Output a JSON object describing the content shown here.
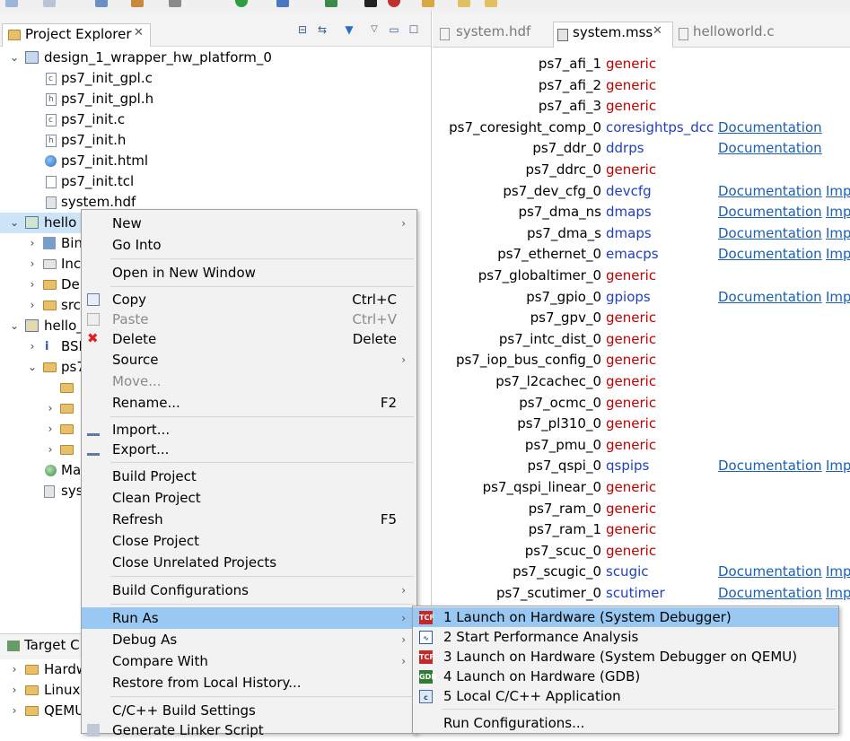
{
  "left_panel": {
    "tab_title": "Project Explorer",
    "tree": [
      {
        "label": "design_1_wrapper_hw_platform_0"
      },
      {
        "label": "ps7_init_gpl.c"
      },
      {
        "label": "ps7_init_gpl.h"
      },
      {
        "label": "ps7_init.c"
      },
      {
        "label": "ps7_init.h"
      },
      {
        "label": "ps7_init.html"
      },
      {
        "label": "ps7_init.tcl"
      },
      {
        "label": "system.hdf"
      },
      {
        "label": "hello"
      },
      {
        "label": "Bin"
      },
      {
        "label": "Inc"
      },
      {
        "label": "De"
      },
      {
        "label": "src"
      },
      {
        "label": "hello_"
      },
      {
        "label": "BSI"
      },
      {
        "label": "ps7"
      },
      {
        "label": "Ma"
      },
      {
        "label": "sys"
      }
    ]
  },
  "target_panel": {
    "tab_title": "Target C",
    "items": [
      "Hardw",
      "Linux",
      "QEMU"
    ]
  },
  "editor": {
    "tabs": [
      {
        "label": "system.hdf"
      },
      {
        "label": "system.mss"
      },
      {
        "label": "helloworld.c"
      }
    ],
    "doc_label": "Documentation",
    "imp_label": "Imp",
    "rows": [
      {
        "name": "ps7_afi_1",
        "driver": "generic",
        "doc": false,
        "imp": false
      },
      {
        "name": "ps7_afi_2",
        "driver": "generic",
        "doc": false,
        "imp": false
      },
      {
        "name": "ps7_afi_3",
        "driver": "generic",
        "doc": false,
        "imp": false
      },
      {
        "name": "ps7_coresight_comp_0",
        "driver": "coresightps_dcc",
        "doc": true,
        "imp": false
      },
      {
        "name": "ps7_ddr_0",
        "driver": "ddrps",
        "doc": true,
        "imp": false
      },
      {
        "name": "ps7_ddrc_0",
        "driver": "generic",
        "doc": false,
        "imp": false
      },
      {
        "name": "ps7_dev_cfg_0",
        "driver": "devcfg",
        "doc": true,
        "imp": true
      },
      {
        "name": "ps7_dma_ns",
        "driver": "dmaps",
        "doc": true,
        "imp": true
      },
      {
        "name": "ps7_dma_s",
        "driver": "dmaps",
        "doc": true,
        "imp": true
      },
      {
        "name": "ps7_ethernet_0",
        "driver": "emacps",
        "doc": true,
        "imp": true
      },
      {
        "name": "ps7_globaltimer_0",
        "driver": "generic",
        "doc": false,
        "imp": false
      },
      {
        "name": "ps7_gpio_0",
        "driver": "gpiops",
        "doc": true,
        "imp": true
      },
      {
        "name": "ps7_gpv_0",
        "driver": "generic",
        "doc": false,
        "imp": false
      },
      {
        "name": "ps7_intc_dist_0",
        "driver": "generic",
        "doc": false,
        "imp": false
      },
      {
        "name": "ps7_iop_bus_config_0",
        "driver": "generic",
        "doc": false,
        "imp": false
      },
      {
        "name": "ps7_l2cachec_0",
        "driver": "generic",
        "doc": false,
        "imp": false
      },
      {
        "name": "ps7_ocmc_0",
        "driver": "generic",
        "doc": false,
        "imp": false
      },
      {
        "name": "ps7_pl310_0",
        "driver": "generic",
        "doc": false,
        "imp": false
      },
      {
        "name": "ps7_pmu_0",
        "driver": "generic",
        "doc": false,
        "imp": false
      },
      {
        "name": "ps7_qspi_0",
        "driver": "qspips",
        "doc": true,
        "imp": true
      },
      {
        "name": "ps7_qspi_linear_0",
        "driver": "generic",
        "doc": false,
        "imp": false
      },
      {
        "name": "ps7_ram_0",
        "driver": "generic",
        "doc": false,
        "imp": false
      },
      {
        "name": "ps7_ram_1",
        "driver": "generic",
        "doc": false,
        "imp": false
      },
      {
        "name": "ps7_scuc_0",
        "driver": "generic",
        "doc": false,
        "imp": false
      },
      {
        "name": "ps7_scugic_0",
        "driver": "scugic",
        "doc": true,
        "imp": true
      },
      {
        "name": "ps7_scutimer_0",
        "driver": "scutimer",
        "doc": true,
        "imp": true
      }
    ]
  },
  "context_menu": {
    "items": [
      {
        "label": "New",
        "submenu": true
      },
      {
        "label": "Go Into"
      },
      {
        "label": "Open in New Window"
      },
      {
        "label": "Copy",
        "shortcut": "Ctrl+C"
      },
      {
        "label": "Paste",
        "shortcut": "Ctrl+V",
        "disabled": true
      },
      {
        "label": "Delete",
        "shortcut": "Delete"
      },
      {
        "label": "Source",
        "submenu": true
      },
      {
        "label": "Move...",
        "disabled": true
      },
      {
        "label": "Rename...",
        "shortcut": "F2"
      },
      {
        "label": "Import..."
      },
      {
        "label": "Export..."
      },
      {
        "label": "Build Project"
      },
      {
        "label": "Clean Project"
      },
      {
        "label": "Refresh",
        "shortcut": "F5"
      },
      {
        "label": "Close Project"
      },
      {
        "label": "Close Unrelated Projects"
      },
      {
        "label": "Build Configurations",
        "submenu": true
      },
      {
        "label": "Run As",
        "submenu": true,
        "highlighted": true
      },
      {
        "label": "Debug As",
        "submenu": true
      },
      {
        "label": "Compare With",
        "submenu": true
      },
      {
        "label": "Restore from Local History..."
      },
      {
        "label": "C/C++ Build Settings"
      },
      {
        "label": "Generate Linker Script"
      }
    ]
  },
  "run_as_submenu": {
    "items": [
      {
        "label": "1 Launch on Hardware (System Debugger)",
        "icon": "tcf-launch-icon",
        "highlighted": true
      },
      {
        "label": "2 Start Performance Analysis",
        "icon": "performance-chart-icon"
      },
      {
        "label": "3 Launch on Hardware (System Debugger on QEMU)",
        "icon": "tcf-launch-icon"
      },
      {
        "label": "4 Launch on Hardware (GDB)",
        "icon": "gdb-launch-icon"
      },
      {
        "label": "5 Local C/C++ Application",
        "icon": "c-application-icon"
      },
      {
        "label": "Run Configurations..."
      }
    ]
  },
  "colors": {
    "menu_highlight": "#99c9f3",
    "driver_generic": "#c00000",
    "driver_specific": "#1f3fbf",
    "link": "#1a5fb4"
  }
}
